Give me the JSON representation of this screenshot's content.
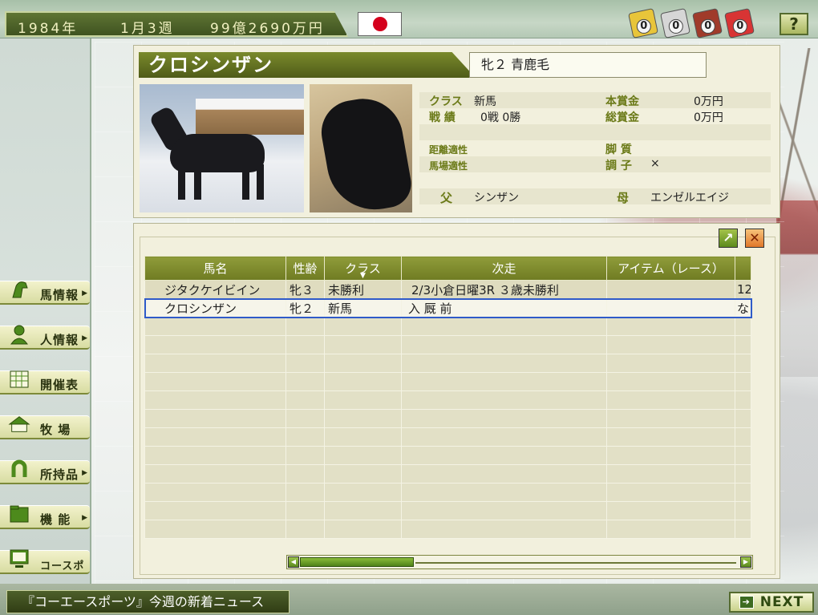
{
  "topbar": {
    "year": "1984年",
    "week": "1月3週",
    "funds": "99億2690万円",
    "tokens": [
      {
        "value": "0",
        "color": "#e8c53a"
      },
      {
        "value": "0",
        "color": "#d6d6d6"
      },
      {
        "value": "0",
        "color": "#a03a2a"
      },
      {
        "value": "0",
        "color": "#d83434"
      }
    ],
    "help_label": "?"
  },
  "menu": [
    {
      "label": "馬情報",
      "icon": "horse-head-icon",
      "has_arrow": true
    },
    {
      "label": "人情報",
      "icon": "person-icon",
      "has_arrow": true
    },
    {
      "label": "開催表",
      "icon": "calendar-icon",
      "has_arrow": false
    },
    {
      "label": "牧 場",
      "icon": "farm-icon",
      "has_arrow": false
    },
    {
      "label": "所持品",
      "icon": "horseshoe-icon",
      "has_arrow": true
    },
    {
      "label": "機 能",
      "icon": "folder-icon",
      "has_arrow": true
    },
    {
      "label": "コースポ",
      "icon": "monitor-icon",
      "has_arrow": false
    }
  ],
  "horse": {
    "name": "クロシンザン",
    "sex_age_coat": "牝２ 青鹿毛",
    "class_label": "クラス",
    "class_value": "新馬",
    "record_label": "戦 績",
    "record_value": "0戦 0勝",
    "prize_label": "本賞金",
    "prize_value": "0万円",
    "total_prize_label": "総賞金",
    "total_prize_value": "0万円",
    "distance_label": "距離適性",
    "distance_value": "",
    "track_label": "馬場適性",
    "track_value": "",
    "leg_label": "脚 質",
    "leg_value": "",
    "condition_label": "調 子",
    "condition_value": "×",
    "sire_label": "父",
    "sire_value": "シンザン",
    "dam_label": "母",
    "dam_value": "エンゼルエイジ"
  },
  "table": {
    "columns": [
      "馬名",
      "性齢",
      "クラス",
      "次走",
      "アイテム（レース）",
      ""
    ],
    "rows": [
      [
        "ジタクケイビイン",
        "牝３",
        "未勝利",
        "2/3小倉日曜3R ３歳未勝利",
        "",
        "12"
      ],
      [
        "クロシンザン",
        "牝２",
        "新馬",
        "入 厩 前",
        "",
        "な"
      ]
    ]
  },
  "bottom": {
    "news": "『コーエースポーツ』今週の新着ニュース",
    "next_label": "NEXT"
  }
}
